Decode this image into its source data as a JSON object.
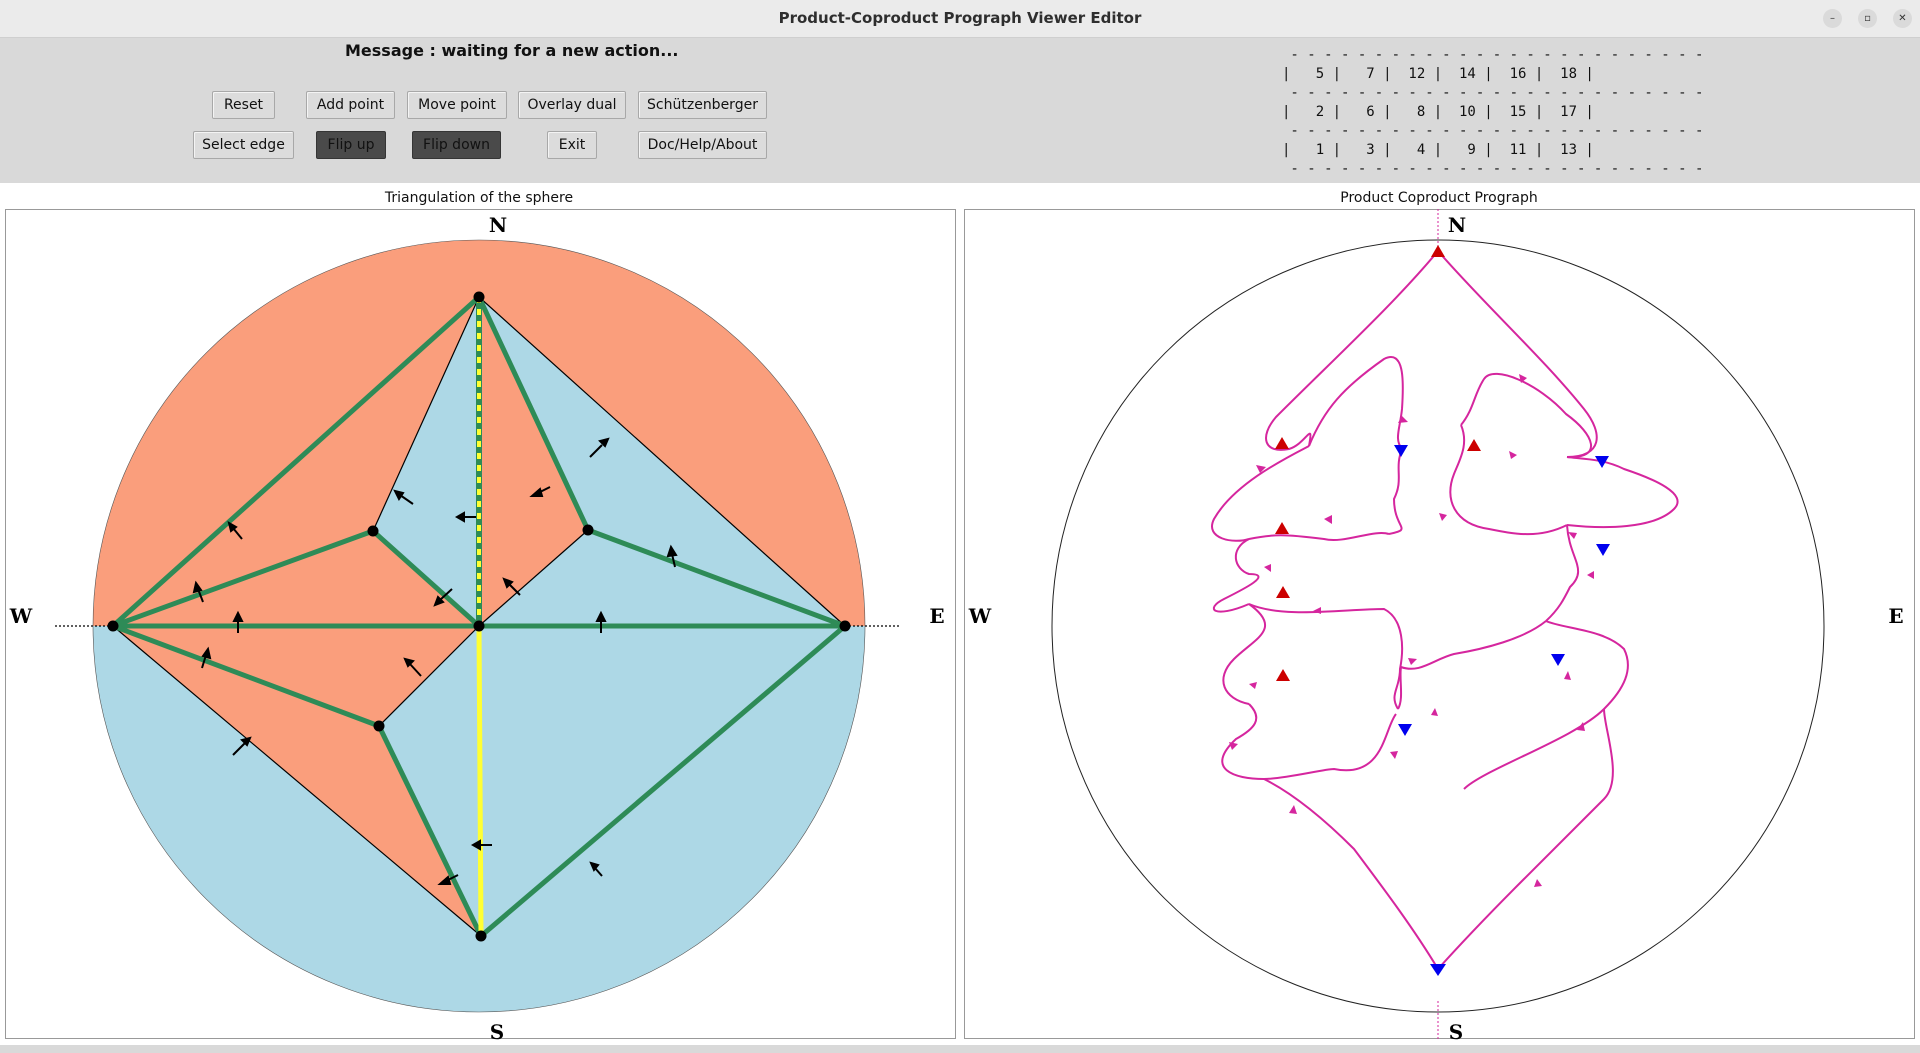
{
  "window": {
    "title": "Product-Coproduct Prograph Viewer Editor"
  },
  "message": "Message : waiting for a new action...",
  "buttons": {
    "reset": "Reset",
    "add_point": "Add point",
    "move_point": "Move point",
    "overlay_dual": "Overlay dual",
    "schutzenberger": "Schützenberger",
    "select_edge": "Select edge",
    "flip_up": "Flip up",
    "flip_down": "Flip down",
    "exit": "Exit",
    "doc_help": "Doc/Help/About"
  },
  "permutation_table": {
    "rows": [
      [
        "5",
        "7",
        "12",
        "14",
        "16",
        "18"
      ],
      [
        "2",
        "6",
        "8",
        "10",
        "15",
        "17"
      ],
      [
        "1",
        "3",
        "4",
        "9",
        "11",
        "13"
      ]
    ]
  },
  "left_panel": {
    "title": "Triangulation of the sphere",
    "compass": {
      "north": "N",
      "south": "S",
      "west": "W",
      "east": "E"
    }
  },
  "right_panel": {
    "title": "Product Coproduct Prograph",
    "compass": {
      "north": "N",
      "south": "S",
      "west": "W",
      "east": "E"
    }
  },
  "colors": {
    "salmon_face": "#fa9e7c",
    "blue_face": "#add8e6",
    "green_edge": "#2e8b57",
    "yellow_edge": "#ffff33",
    "magenta_curve": "#d5269e",
    "product_vertex": "#cc0000",
    "coproduct_vertex": "#0000ee"
  }
}
